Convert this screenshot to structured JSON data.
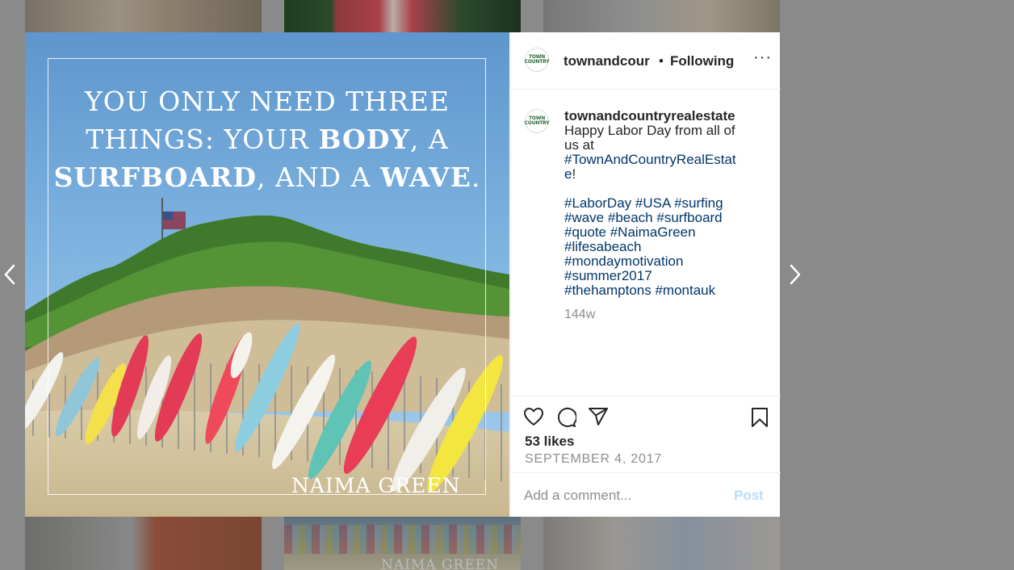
{
  "post": {
    "image": {
      "quote_lines": [
        "YOU ONLY NEED THREE",
        "THINGS: YOUR ",
        "BODY",
        ", A",
        "SURFBOARD",
        ", AND A ",
        "WAVE",
        "."
      ],
      "author": "NAIMA GREEN"
    },
    "header": {
      "avatar_text_1": "TOWN",
      "avatar_text_2": "COUNTRY",
      "username": "townandcountryrealestate",
      "username_truncated": "townandcour",
      "separator": "•",
      "follow_status": "Following",
      "more": "···"
    },
    "caption": {
      "username": "townandcountryrealestate",
      "line_1": "Happy Labor Day from all of",
      "line_2": "us at",
      "tag_line_1": "#TownAndCountryRealEstat",
      "tag_line_1b": "e",
      "tag_line_1c": "!",
      "hashtags": [
        "#LaborDay #USA #surfing",
        "#wave #beach #surfboard",
        "#quote #NaimaGreen",
        "#lifesabeach",
        "#mondaymotivation",
        "#summer2017",
        "#thehamptons #montauk"
      ],
      "age": "144w"
    },
    "stats": {
      "likes": "53 likes",
      "date": "SEPTEMBER 4, 2017"
    },
    "comment": {
      "placeholder": "Add a comment...",
      "post_label": "Post"
    }
  },
  "icons": [
    "heart-icon",
    "comment-icon",
    "share-icon",
    "bookmark-icon",
    "chevron-left-icon",
    "chevron-right-icon"
  ],
  "colors": {
    "link": "#00376b",
    "muted": "#8e8e8e",
    "post_disabled": "#b2dffc",
    "text": "#262626"
  }
}
